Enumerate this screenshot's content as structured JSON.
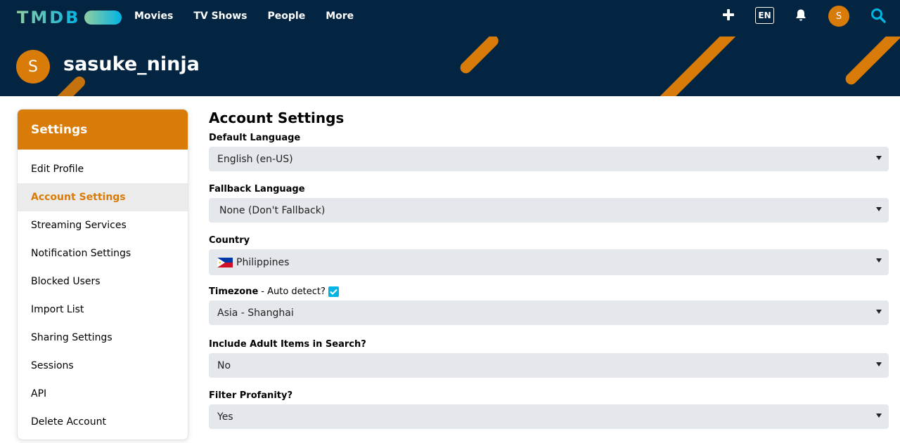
{
  "nav": {
    "logo": "TMDB",
    "links": [
      "Movies",
      "TV Shows",
      "People",
      "More"
    ],
    "language": "EN",
    "avatar_initial": "S"
  },
  "banner": {
    "avatar_initial": "S",
    "username": "sasuke_ninja"
  },
  "sidebar": {
    "title": "Settings",
    "items": [
      {
        "label": "Edit Profile"
      },
      {
        "label": "Account Settings",
        "active": true
      },
      {
        "label": "Streaming Services"
      },
      {
        "label": "Notification Settings"
      },
      {
        "label": "Blocked Users"
      },
      {
        "label": "Import List"
      },
      {
        "label": "Sharing Settings"
      },
      {
        "label": "Sessions"
      },
      {
        "label": "API"
      },
      {
        "label": "Delete Account"
      }
    ]
  },
  "main": {
    "title": "Account Settings",
    "fields": {
      "default_language": {
        "label": "Default Language",
        "value": "English (en-US)"
      },
      "fallback_language": {
        "label": "Fallback Language",
        "value": "None (Don't Fallback)"
      },
      "country": {
        "label": "Country",
        "value": "Philippines"
      },
      "timezone": {
        "label": "Timezone",
        "sub_label": "- Auto detect?",
        "auto_detect": true,
        "value": "Asia - Shanghai"
      },
      "adult": {
        "label": "Include Adult Items in Search?",
        "value": "No"
      },
      "profanity": {
        "label": "Filter Profanity?",
        "value": "Yes"
      }
    }
  },
  "colors": {
    "navy": "#032541",
    "orange": "#d97b08",
    "accent_blue": "#01b4e4",
    "select_bg": "#e4e7eb"
  },
  "icons": [
    "plus-icon",
    "bell-icon",
    "search-icon",
    "chevron-down-icon",
    "check-icon",
    "philippines-flag-icon"
  ]
}
